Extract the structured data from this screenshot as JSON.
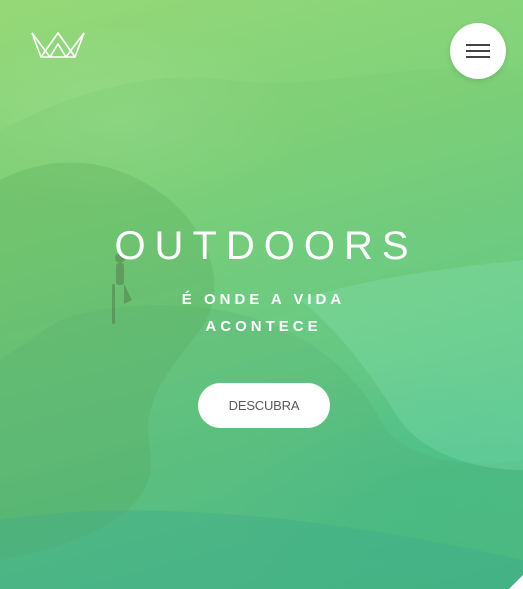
{
  "header": {
    "logo_icon": "crown-icon",
    "menu_icon": "hamburger-icon"
  },
  "hero": {
    "title": "OUTDOORS",
    "subtitle": "É ONDE A VIDA ACONTECE",
    "cta_label": "DESCUBRA"
  },
  "colors": {
    "gradient_top": "#96d878",
    "gradient_bottom": "#3cb98f",
    "text": "#ffffff",
    "button_bg": "#ffffff",
    "button_text": "#5a5a5a"
  }
}
